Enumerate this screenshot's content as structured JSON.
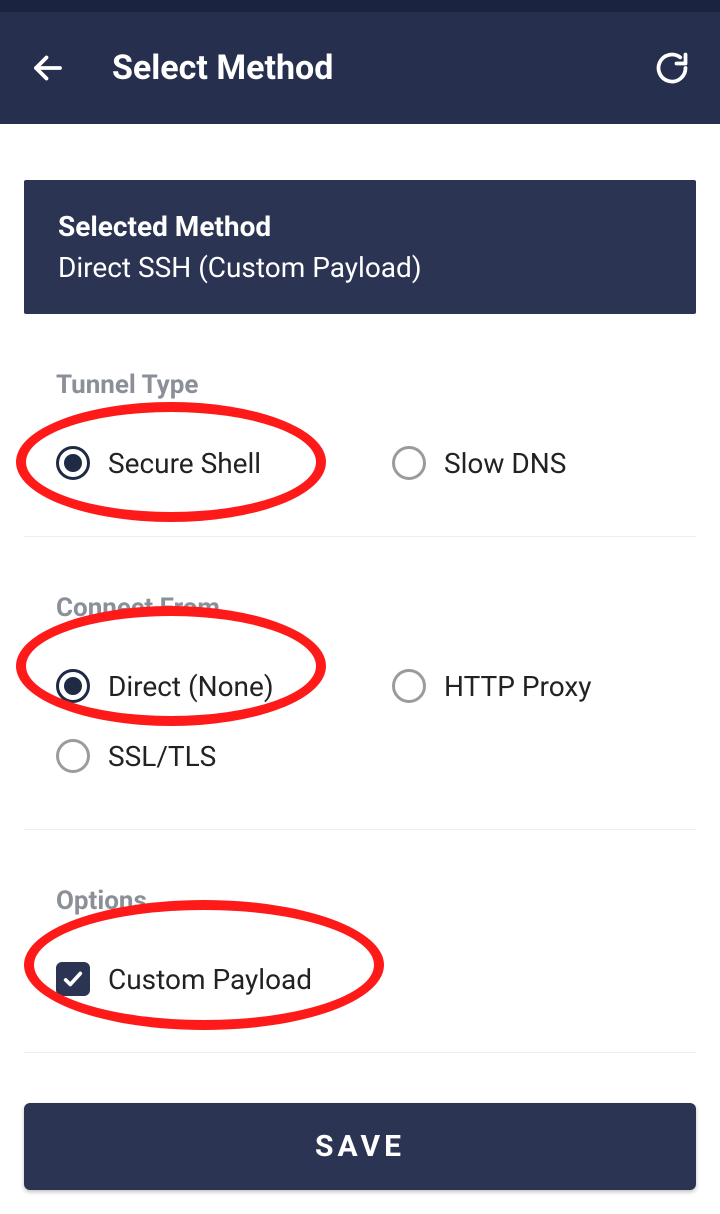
{
  "appbar": {
    "title": "Select Method"
  },
  "selected_card": {
    "title": "Selected Method",
    "value": "Direct SSH (Custom Payload)"
  },
  "sections": {
    "tunnel_type": {
      "label": "Tunnel Type",
      "options": {
        "secure_shell": "Secure Shell",
        "slow_dns": "Slow DNS"
      },
      "selected": "secure_shell"
    },
    "connect_from": {
      "label": "Connect From",
      "options": {
        "direct": "Direct (None)",
        "http_proxy": "HTTP Proxy",
        "ssl_tls": "SSL/TLS"
      },
      "selected": "direct"
    },
    "options": {
      "label": "Options",
      "custom_payload": {
        "label": "Custom Payload",
        "checked": true
      }
    }
  },
  "save_button": "SAVE"
}
